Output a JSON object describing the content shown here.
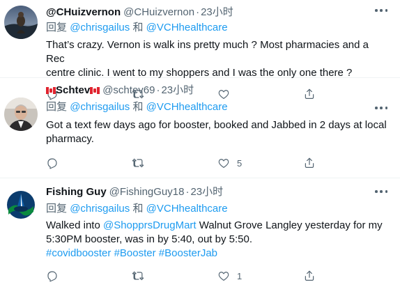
{
  "reply_prefix": "回复",
  "conjunction": "和",
  "tweets": [
    {
      "display_name": "@CHuizvernon",
      "handle": "@CHuizvernon",
      "time": "23小时",
      "mentions": [
        "@chrisgailus",
        "@VCHhealthcare"
      ],
      "lines": [
        "That’s crazy. Vernon is walk ins pretty much ? Most pharmacies and a Rec",
        "centre clinic. I went to my shoppers and I was the only one there ?"
      ],
      "reply_count": "",
      "retweet_count": "",
      "like_count": ""
    },
    {
      "display_name": "Schtev",
      "handle": "@schtev69",
      "time": "23小时",
      "mentions": [
        "@chrisgailus",
        "@VCHhealthcare"
      ],
      "lines": [
        "Got a text few days ago for booster, booked and Jabbed in 2 days at local",
        "pharmacy."
      ],
      "reply_count": "",
      "retweet_count": "",
      "like_count": "5"
    },
    {
      "display_name": "Fishing Guy",
      "handle": "@FishingGuy18",
      "time": "23小时",
      "mentions": [
        "@chrisgailus",
        "@VCHhealthcare"
      ],
      "body_line1_prefix": "Walked into ",
      "body_line1_mention": "@ShopprsDrugMart",
      "body_line1_suffix": " Walnut Grove Langley yesterday for my",
      "body_line2": "5:30PM booster, was in by 5:40, out by 5:50.",
      "hashtags": [
        "#covidbooster",
        "#Booster",
        "#BoosterJab"
      ],
      "reply_count": "",
      "retweet_count": "",
      "like_count": "1"
    }
  ],
  "colors": {
    "link": "#1d9bf0",
    "secondary": "#536471",
    "text": "#0f1419",
    "divider": "#eff3f4"
  }
}
